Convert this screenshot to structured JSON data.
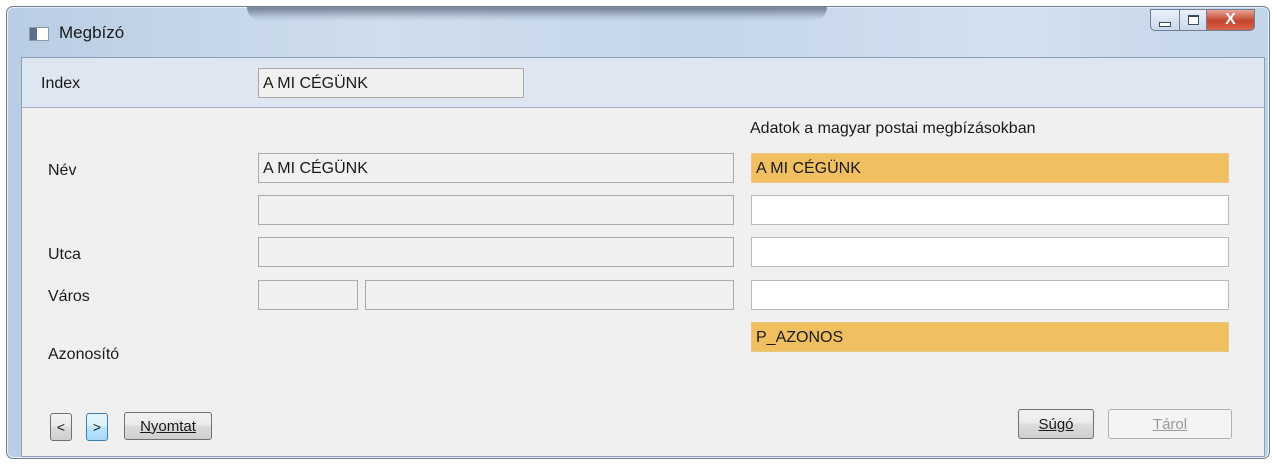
{
  "window": {
    "title": "Megbízó",
    "controls": {
      "minimize_icon": "minimize-icon",
      "maximize_icon": "maximize-icon",
      "close_icon": "close-icon",
      "close_glyph": "X"
    }
  },
  "form": {
    "index": {
      "label": "Index",
      "value": "A MI CÉGÜNK"
    },
    "section_header": "Adatok a magyar postai megbízásokban",
    "nev": {
      "label": "Név",
      "value": "A MI CÉGÜNK",
      "postal_value": "A MI CÉGÜNK"
    },
    "nev2": {
      "value": "",
      "postal_value": ""
    },
    "utca": {
      "label": "Utca",
      "value": "",
      "postal_value": ""
    },
    "varos": {
      "label": "Város",
      "zip_value": "",
      "city_value": "",
      "postal_value": ""
    },
    "azonosito": {
      "label": "Azonosító",
      "postal_value": "P_AZONOS"
    }
  },
  "buttons": {
    "prev": "<",
    "next": ">",
    "print": "Nyomtat",
    "help": "Súgó",
    "save": "Tárol"
  },
  "colors": {
    "highlight_field": "#f0c060",
    "client_bg": "#f0f0f0",
    "index_band": "#dee6f1"
  }
}
